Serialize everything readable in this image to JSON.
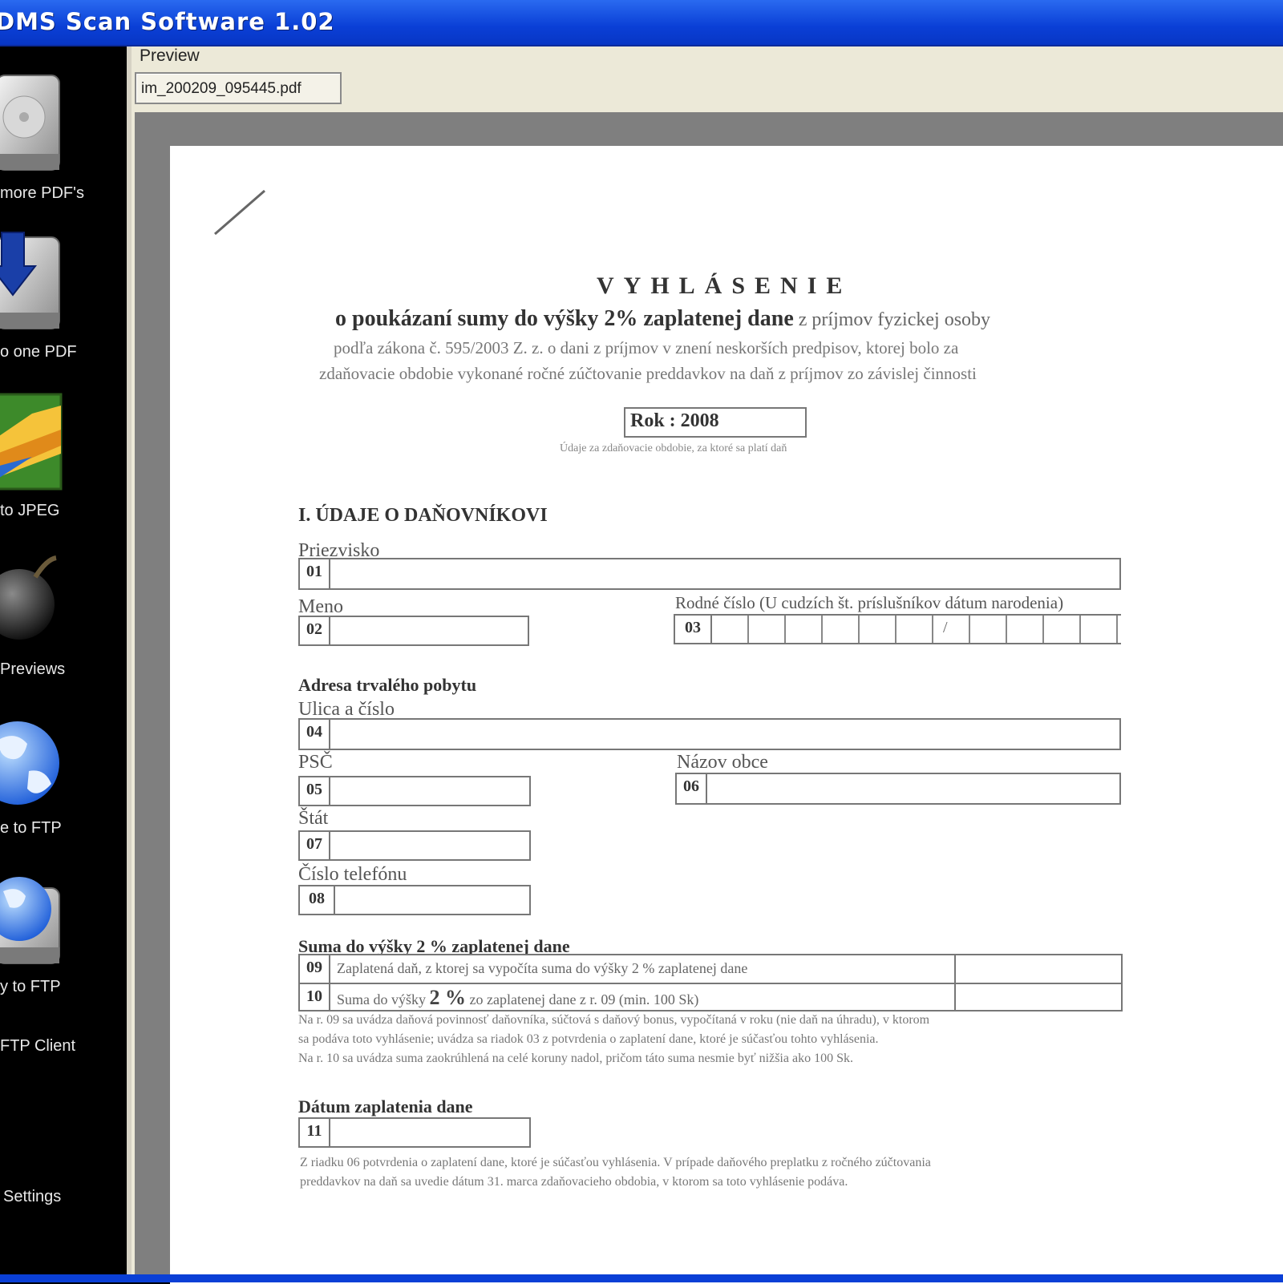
{
  "window": {
    "title": "DMS Scan Software 1.02"
  },
  "sidebar": {
    "items": [
      {
        "label": "more PDF's",
        "icon": "disk-icon"
      },
      {
        "label": "o one PDF",
        "icon": "disk-download-icon"
      },
      {
        "label": "to JPEG",
        "icon": "picture-icon"
      },
      {
        "label": "Previews",
        "icon": "bomb-icon"
      },
      {
        "label": "e to FTP",
        "icon": "globe-icon"
      },
      {
        "label": "y to FTP",
        "icon": "globe-disk-icon"
      },
      {
        "label": "FTP Client",
        "icon": ""
      },
      {
        "label": "Settings",
        "icon": ""
      }
    ]
  },
  "preview": {
    "label": "Preview",
    "file_tab": "im_200209_095445.pdf"
  },
  "document": {
    "heading": "VYHLÁSENIE",
    "subheading_bold": "o poukázaní sumy do výšky 2% zaplatenej dane",
    "subheading_rest": " z príjmov fyzickej osoby",
    "intro_line2": "podľa zákona č. 595/2003 Z. z. o dani z príjmov v znení neskorších predpisov, ktorej bolo za",
    "intro_line3": "zdaňovacie obdobie vykonané ročné zúčtovanie preddavkov na daň z príjmov zo závislej činnosti",
    "year_box": "Rok : 2008",
    "year_note": "Údaje za zdaňovacie obdobie, za ktoré sa platí daň",
    "section1": "I. ÚDAJE O DAŇOVNÍKOVI",
    "fields": {
      "surname": {
        "label": "Priezvisko",
        "num": "01"
      },
      "name": {
        "label": "Meno",
        "num": "02"
      },
      "birth": {
        "label": "Rodné číslo (U cudzích št. príslušníkov dátum narodenia)",
        "num": "03",
        "slash": "/"
      },
      "address_title": "Adresa trvalého pobytu",
      "street": {
        "label": "Ulica a číslo",
        "num": "04"
      },
      "psc": {
        "label": "PSČ",
        "num": "05"
      },
      "town": {
        "label": "Názov obce",
        "num": "06"
      },
      "state": {
        "label": "Štát",
        "num": "07"
      },
      "phone": {
        "label": "Číslo telefónu",
        "num": "08"
      }
    },
    "sum_section": {
      "title": "Suma do výšky 2 % zaplatenej dane",
      "rows": [
        {
          "num": "09",
          "text": "Zaplatená daň, z ktorej sa vypočíta suma do výšky 2 % zaplatenej dane"
        },
        {
          "num": "10",
          "text_a": "Suma do výšky ",
          "text_b": "2 %",
          "text_c": " zo zaplatenej dane z r. 09 (min. 100 Sk)"
        }
      ],
      "note1": "Na r. 09 sa uvádza daňová povinnosť daňovníka, súčtová s daňový bonus, vypočítaná v roku (nie daň na úhradu), v ktorom",
      "note2": "sa podáva toto vyhlásenie; uvádza sa riadok 03 z potvrdenia o zaplatení dane, ktoré je súčasťou tohto vyhlásenia.",
      "note3": "Na r. 10 sa uvádza suma zaokrúhlená na celé koruny nadol, pričom táto suma nesmie byť nižšia ako 100 Sk."
    },
    "date_section": {
      "title": "Dátum zaplatenia dane",
      "num": "11",
      "note1": "Z riadku 06 potvrdenia o zaplatení dane, ktoré je súčasťou vyhlásenia. V prípade daňového preplatku z ročného zúčtovania",
      "note2": "preddavkov na daň sa uvedie dátum 31. marca zdaňovacieho obdobia, v ktorom sa toto vyhlásenie podáva."
    }
  }
}
